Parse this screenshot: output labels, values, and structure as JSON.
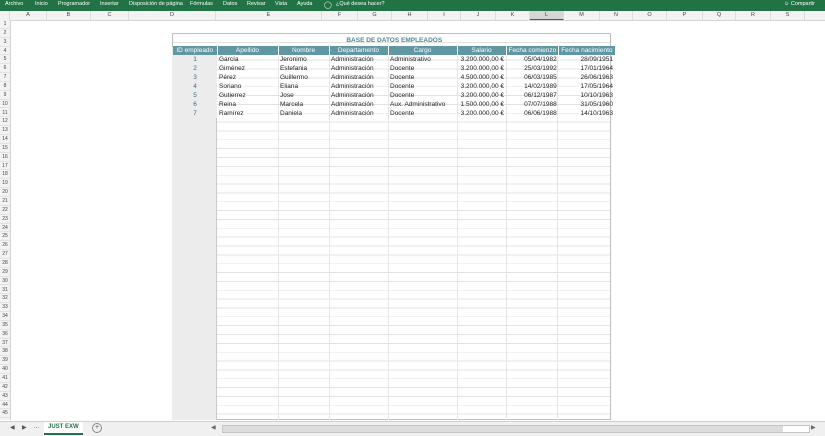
{
  "ribbon": {
    "tabs": [
      "Archivo",
      "Inicio",
      "Programador",
      "Insertar",
      "Disposición de página",
      "Fórmulas",
      "Datos",
      "Revisar",
      "Vista",
      "Ayuda"
    ],
    "tell_me": "¿Qué desea hacer?",
    "share": "Compartir"
  },
  "columns": [
    "A",
    "B",
    "C",
    "D",
    "E",
    "F",
    "G",
    "H",
    "I",
    "J",
    "K",
    "L",
    "M",
    "N",
    "O",
    "P",
    "Q",
    "R",
    "S"
  ],
  "rows": [
    "1",
    "2",
    "3",
    "4",
    "5",
    "6",
    "7",
    "8",
    "9",
    "10",
    "11",
    "12",
    "13",
    "14",
    "15",
    "16",
    "17",
    "18",
    "19",
    "20",
    "21",
    "22",
    "23",
    "24",
    "25",
    "26",
    "27",
    "28",
    "29",
    "30",
    "31",
    "32",
    "33",
    "34",
    "35",
    "36",
    "37",
    "38",
    "39",
    "40",
    "41",
    "42",
    "43",
    "44",
    "45"
  ],
  "table": {
    "title": "BASE DE DATOS EMPLEADOS",
    "headers": [
      "ID empleado",
      "Apellido",
      "Nombre",
      "Departamento",
      "Cargo",
      "Salario",
      "Fecha comienzo",
      "Fecha nacimiento"
    ],
    "rows": [
      [
        "1",
        "García",
        "Jeronimo",
        "Administración",
        "Administrativo",
        "3.200.000,00 €",
        "05/04/1982",
        "28/09/1951"
      ],
      [
        "2",
        "Giménez",
        "Estefania",
        "Administración",
        "Docente",
        "3.200.000,00 €",
        "25/03/1992",
        "17/01/1964"
      ],
      [
        "3",
        "Pérez",
        "Guillermo",
        "Administración",
        "Docente",
        "4.500.000,00 €",
        "06/03/1985",
        "26/06/1963"
      ],
      [
        "4",
        "Soriano",
        "Eliana",
        "Administración",
        "Docente",
        "3.200.000,00 €",
        "14/02/1989",
        "17/05/1964"
      ],
      [
        "5",
        "Gutierrez",
        "Jose",
        "Administración",
        "Docente",
        "3.200.000,00 €",
        "06/12/1987",
        "10/10/1963"
      ],
      [
        "6",
        "Reina",
        "Marcela",
        "Administración",
        "Aux. Administrativo",
        "1.500.000,00 €",
        "07/07/1988",
        "31/05/1960"
      ],
      [
        "7",
        "Ramírez",
        "Daniela",
        "Administración",
        "Docente",
        "3.200.000,00 €",
        "06/06/1988",
        "14/10/1963"
      ]
    ]
  },
  "bottom": {
    "ellipsis": "...",
    "sheet_name": "JUST EXW",
    "add_sheet": "+"
  }
}
